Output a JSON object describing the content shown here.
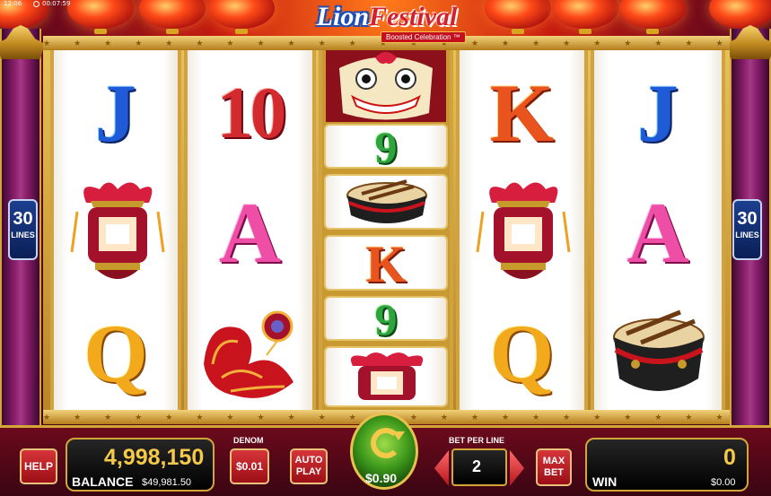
{
  "status_bar": {
    "clock": "12:06",
    "timer": "00:07:59"
  },
  "logo": {
    "word1": "Lion",
    "word2": "Festival",
    "subtitle": "Boosted Celebration",
    "tm": "™"
  },
  "lines": {
    "count": "30",
    "label": "LINES"
  },
  "reels": {
    "reel1": {
      "top": "J",
      "middle": "lantern",
      "bottom": "Q"
    },
    "reel2": {
      "top": "10",
      "middle": "A",
      "bottom": "firecrackers"
    },
    "reel3": {
      "top": "lion-head",
      "row2": "9",
      "row3": "drum",
      "row4": "K",
      "row5": "9",
      "row6": "lantern"
    },
    "reel4": {
      "top": "K",
      "middle": "lantern",
      "bottom": "Q"
    },
    "reel5": {
      "top": "J",
      "middle": "A",
      "bottom": "drum"
    }
  },
  "console": {
    "help_label": "HELP",
    "credits": "4,998,150",
    "balance_label": "BALANCE",
    "balance_value": "$49,981.50",
    "denom_label": "DENOM",
    "denom_value": "$0.01",
    "autoplay_line1": "AUTO",
    "autoplay_line2": "PLAY",
    "spin_bet": "$0.90",
    "bet_per_line_label": "BET PER LINE",
    "bet_per_line_value": "2",
    "max_bet_line1": "MAX",
    "max_bet_line2": "BET",
    "win_credits": "0",
    "win_label": "WIN",
    "win_value": "$0.00"
  },
  "colors": {
    "accent_gold": "#d4a637",
    "console_red": "#6b0a1c",
    "spin_green": "#3f9a1c",
    "lines_blue": "#1c3f8f"
  }
}
